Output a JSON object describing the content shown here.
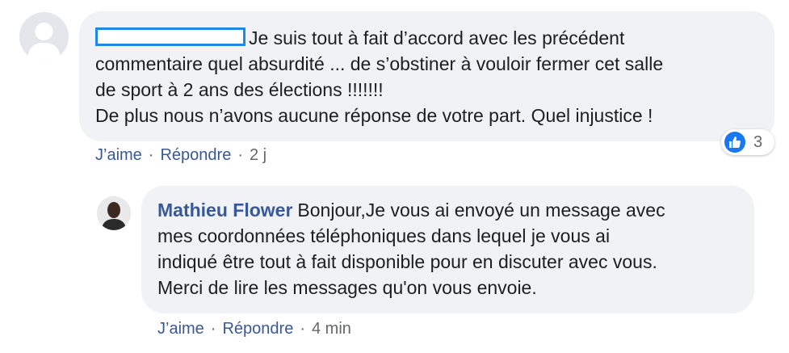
{
  "comment": {
    "text_line1": "Je suis tout à fait d’accord avec les précédent",
    "text_line2": "commentaire quel absurdité ... de s’obstiner à vouloir fermer cet salle",
    "text_line3": "de sport à 2 ans des élections !!!!!!!",
    "text_line4": "De plus nous n’avons aucune réponse de votre part. Quel injustice !",
    "like_label": "J’aime",
    "reply_label": "Répondre",
    "time": "2 j",
    "reaction_count": "3",
    "reaction_icon": "like-icon"
  },
  "reply": {
    "author": "Mathieu Flower",
    "text_line1": "Bonjour,Je vous ai envoyé un message avec",
    "text_line2": "mes coordonnées téléphoniques dans lequel je vous ai",
    "text_line3": "indiqué être tout à fait disponible pour en discuter avec vous.",
    "text_line4": "Merci de lire les messages qu'on vous envoie.",
    "like_label": "J’aime",
    "reply_label": "Répondre",
    "time": "4 min"
  },
  "colors": {
    "bubble_bg": "#f0f2f5",
    "link_blue": "#385898",
    "like_blue": "#1877f2",
    "muted": "#65676b"
  }
}
